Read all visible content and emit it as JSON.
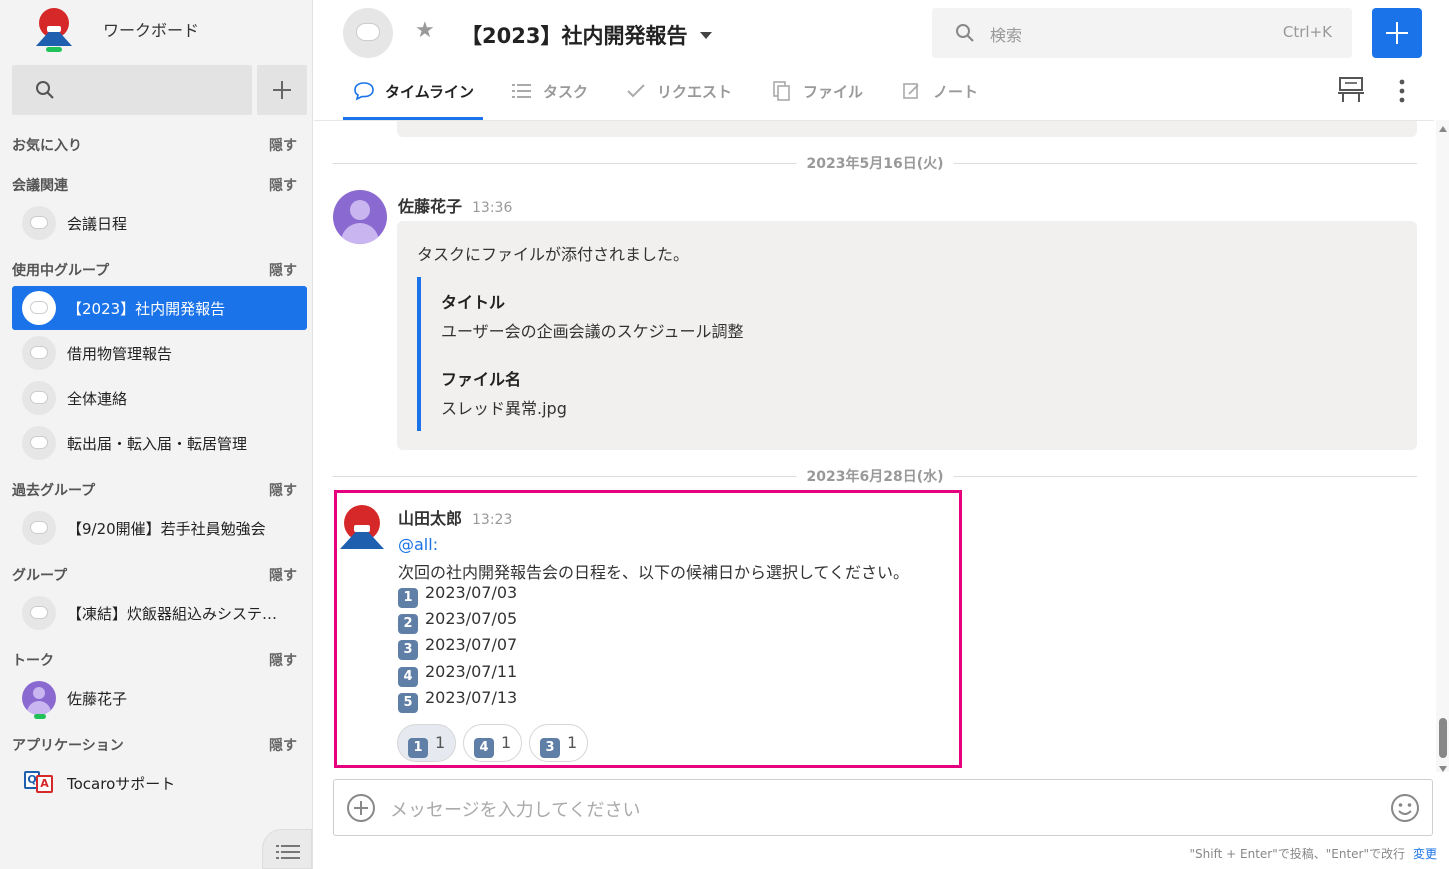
{
  "workspace": {
    "name": "ワークボード"
  },
  "sidebar": {
    "hide_label": "隠す",
    "sections": [
      {
        "title": "お気に入り"
      },
      {
        "title": "会議関連"
      },
      {
        "title": "使用中グループ"
      },
      {
        "title": "過去グループ"
      },
      {
        "title": "グループ"
      },
      {
        "title": "トーク"
      },
      {
        "title": "アプリケーション"
      }
    ],
    "items": {
      "meeting_schedule": "会議日程",
      "active_group": "【2023】社内開発報告",
      "borrowed": "借用物管理報告",
      "all_contact": "全体連絡",
      "transfer": "転出届・転入届・転居管理",
      "study": "【9/20開催】若手社員勉強会",
      "frozen": "【凍結】炊飯器組込みシステ…",
      "talk_user": "佐藤花子",
      "app": "Tocaroサポート"
    }
  },
  "header": {
    "title": "【2023】社内開発報告",
    "search_placeholder": "検索",
    "search_shortcut": "Ctrl+K",
    "tabs": [
      "タイムライン",
      "タスク",
      "リクエスト",
      "ファイル",
      "ノート"
    ]
  },
  "timeline": {
    "date1": "2023年5月16日(火)",
    "msg1": {
      "sender": "佐藤花子",
      "time": "13:36",
      "intro": "タスクにファイルが添付されました。",
      "title_label": "タイトル",
      "title_value": "ユーザー会の企画会議のスケジュール調整",
      "file_label": "ファイル名",
      "file_value": "スレッド異常.jpg"
    },
    "date2": "2023年6月28日(水)",
    "msg2": {
      "sender": "山田太郎",
      "time": "13:23",
      "mention": "@all:",
      "text": "次回の社内開発報告会の日程を、以下の候補日から選択してください。",
      "options": [
        {
          "num": "1",
          "date": "2023/07/03"
        },
        {
          "num": "2",
          "date": "2023/07/05"
        },
        {
          "num": "3",
          "date": "2023/07/07"
        },
        {
          "num": "4",
          "date": "2023/07/11"
        },
        {
          "num": "5",
          "date": "2023/07/13"
        }
      ],
      "reactions": [
        {
          "num": "1",
          "count": "1"
        },
        {
          "num": "4",
          "count": "1"
        },
        {
          "num": "3",
          "count": "1"
        }
      ]
    }
  },
  "composer": {
    "placeholder": "メッセージを入力してください",
    "hint": "\"Shift + Enter\"で投稿、\"Enter\"で改行",
    "change_link": "変更"
  },
  "colors": {
    "accent": "#1a73e8",
    "highlight": "#e6007e"
  }
}
